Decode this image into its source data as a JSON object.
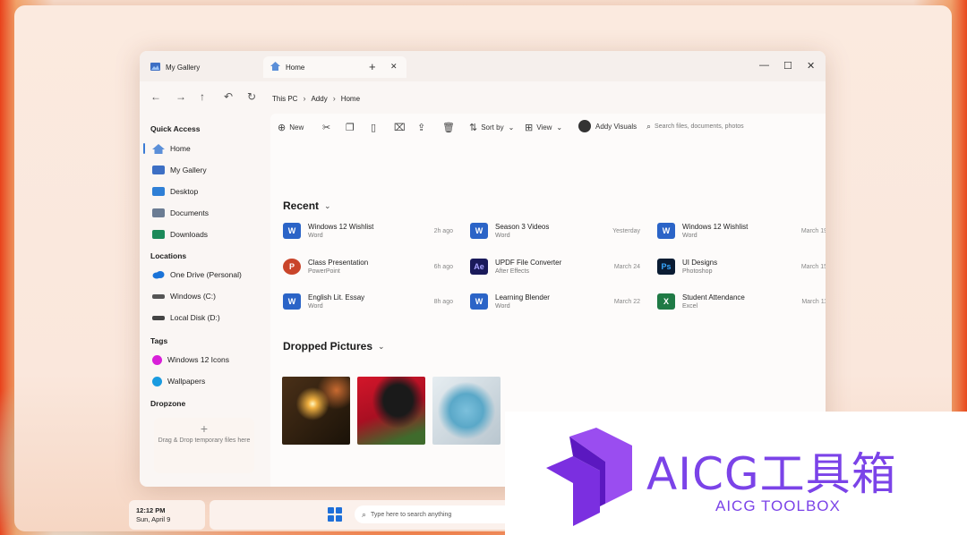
{
  "window": {
    "tabs": [
      {
        "label": "My Gallery",
        "icon": "gallery-icon"
      },
      {
        "label": "Home",
        "icon": "home-icon"
      }
    ]
  },
  "breadcrumb": [
    "This PC",
    "Addy",
    "Home"
  ],
  "sidebar": {
    "quick_access_title": "Quick Access",
    "quick_access": [
      {
        "label": "Home",
        "icon": "home-icon",
        "color": "#5b8fd8"
      },
      {
        "label": "My Gallery",
        "icon": "gallery-icon",
        "color": "#3d6fc4"
      },
      {
        "label": "Desktop",
        "icon": "desktop-folder-icon",
        "color": "#2f7fd6"
      },
      {
        "label": "Documents",
        "icon": "documents-folder-icon",
        "color": "#6b7c93"
      },
      {
        "label": "Downloads",
        "icon": "downloads-folder-icon",
        "color": "#1c8a5a"
      }
    ],
    "locations_title": "Locations",
    "locations": [
      {
        "label": "One Drive (Personal)",
        "icon": "cloud-icon",
        "color": "#1a73d8"
      },
      {
        "label": "Windows (C:)",
        "icon": "drive-icon",
        "color": "#555555"
      },
      {
        "label": "Local Disk (D:)",
        "icon": "drive-icon",
        "color": "#444444"
      }
    ],
    "tags_title": "Tags",
    "tags": [
      {
        "label": "Windows 12 Icons",
        "icon": "tag-dot-icon",
        "color": "#d81fd8"
      },
      {
        "label": "Wallpapers",
        "icon": "tag-dot-icon",
        "color": "#1a9be0"
      }
    ],
    "dropzone_title": "Dropzone",
    "dropzone_text": "Drag & Drop temporary files here"
  },
  "toolbar": {
    "new_label": "New",
    "sort_label": "Sort by",
    "view_label": "View",
    "user_label": "Addy Visuals",
    "search_placeholder": "Search files, documents, photos"
  },
  "recent": {
    "title": "Recent",
    "files": [
      {
        "name": "Windows 12 Wishlist",
        "type": "Word",
        "time": "2h ago",
        "app": "word",
        "glyph": "W"
      },
      {
        "name": "Season 3 Videos",
        "type": "Word",
        "time": "Yesterday",
        "app": "word",
        "glyph": "W"
      },
      {
        "name": "Windows 12 Wishlist",
        "type": "Word",
        "time": "March 19",
        "app": "word",
        "glyph": "W"
      },
      {
        "name": "Class Presentation",
        "type": "PowerPoint",
        "time": "6h ago",
        "app": "ppt",
        "glyph": "P"
      },
      {
        "name": "UPDF File Converter",
        "type": "After Effects",
        "time": "March 24",
        "app": "ae",
        "glyph": "Ae"
      },
      {
        "name": "UI Designs",
        "type": "Photoshop",
        "time": "March 15",
        "app": "ps",
        "glyph": "Ps"
      },
      {
        "name": "English Lit. Essay",
        "type": "Word",
        "time": "8h ago",
        "app": "word",
        "glyph": "W"
      },
      {
        "name": "Learning Blender",
        "type": "Word",
        "time": "March 22",
        "app": "word",
        "glyph": "W"
      },
      {
        "name": "Student Attendance",
        "type": "Excel",
        "time": "March 11",
        "app": "excel",
        "glyph": "X"
      }
    ]
  },
  "dropped": {
    "title": "Dropped Pictures",
    "pictures": [
      "sparkler-photo",
      "red-car-dog-photo",
      "face-mask-photo"
    ]
  },
  "taskbar": {
    "time": "12:12 PM",
    "date": "Sun, April 9",
    "search_placeholder": "Type here to search anything"
  },
  "watermark": {
    "title": "AICG工具箱",
    "subtitle": "AICG TOOLBOX"
  }
}
